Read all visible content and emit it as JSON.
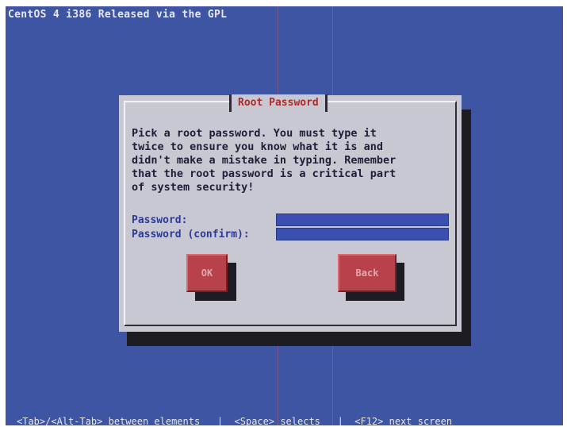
{
  "screen": {
    "top_line": "CentOS 4 i386 Released via the GPL",
    "status_bar": "<Tab>/<Alt-Tab> between elements   |  <Space> selects   |  <F12> next screen"
  },
  "dialog": {
    "title": "Root Password",
    "message": "Pick a root password. You must type it\ntwice to ensure you know what it is and\ndidn't make a mistake in typing. Remember\nthat the root password is a critical part\nof system security!",
    "password_label": "Password:",
    "password_value": "",
    "confirm_label": "Password (confirm):",
    "confirm_value": "",
    "ok_label": "OK",
    "back_label": "Back"
  },
  "colors": {
    "background": "#3d55a3",
    "dialog": "#c8c8d2",
    "button": "#b8424c",
    "input": "#3b4fb0",
    "title_text": "#b02a2a"
  }
}
